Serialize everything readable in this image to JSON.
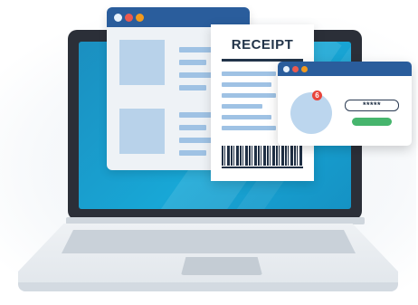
{
  "receipt": {
    "title": "RECEIPT"
  },
  "login": {
    "password_mask": "*****",
    "notification_count": "6"
  },
  "colors": {
    "screen": "#18a7d6",
    "window_bar": "#2a5d9c",
    "dot_red": "#ec5a4e",
    "dot_orange": "#f39a1d",
    "login_button": "#46b56d",
    "notification": "#e8443b"
  }
}
